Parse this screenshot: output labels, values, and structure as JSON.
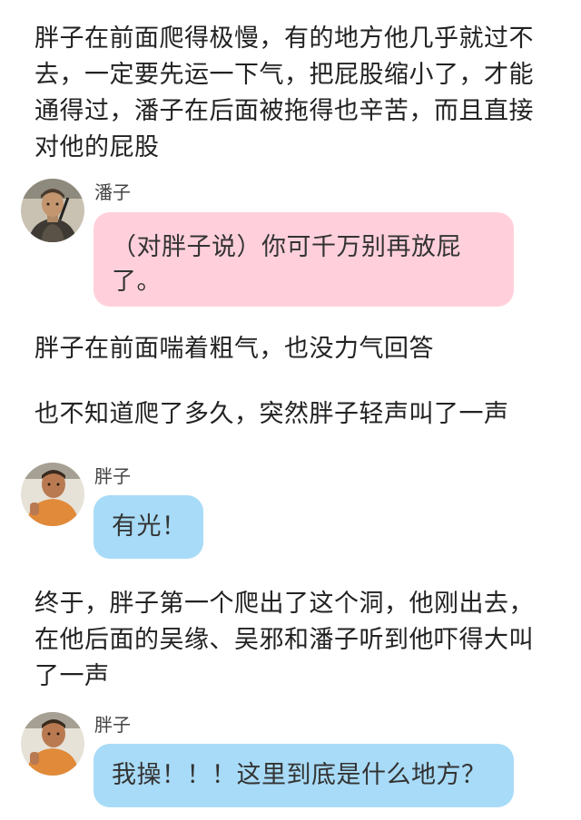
{
  "colors": {
    "pink_bubble": "#ffd0dc",
    "blue_bubble": "#a8dbf7"
  },
  "paragraph_1": "胖子在前面爬得极慢，有的地方他几乎就过不去，一定要先运一下气，把屁股缩小了，才能通得过，潘子在后面被拖得也辛苦，而且直接对他的屁股",
  "message_1": {
    "speaker": "潘子",
    "text": "（对胖子说）你可千万别再放屁了。",
    "avatar_icon": "character-avatar-panzi"
  },
  "paragraph_2": "胖子在前面喘着粗气，也没力气回答",
  "paragraph_3": "也不知道爬了多久，突然胖子轻声叫了一声",
  "message_2": {
    "speaker": "胖子",
    "text": "有光！",
    "avatar_icon": "character-avatar-pangzi"
  },
  "paragraph_4": "终于，胖子第一个爬出了这个洞，他刚出去，在他后面的吴缘、吴邪和潘子听到他吓得大叫了一声",
  "message_3": {
    "speaker": "胖子",
    "text": "我操！！！这里到底是什么地方？",
    "avatar_icon": "character-avatar-pangzi"
  }
}
